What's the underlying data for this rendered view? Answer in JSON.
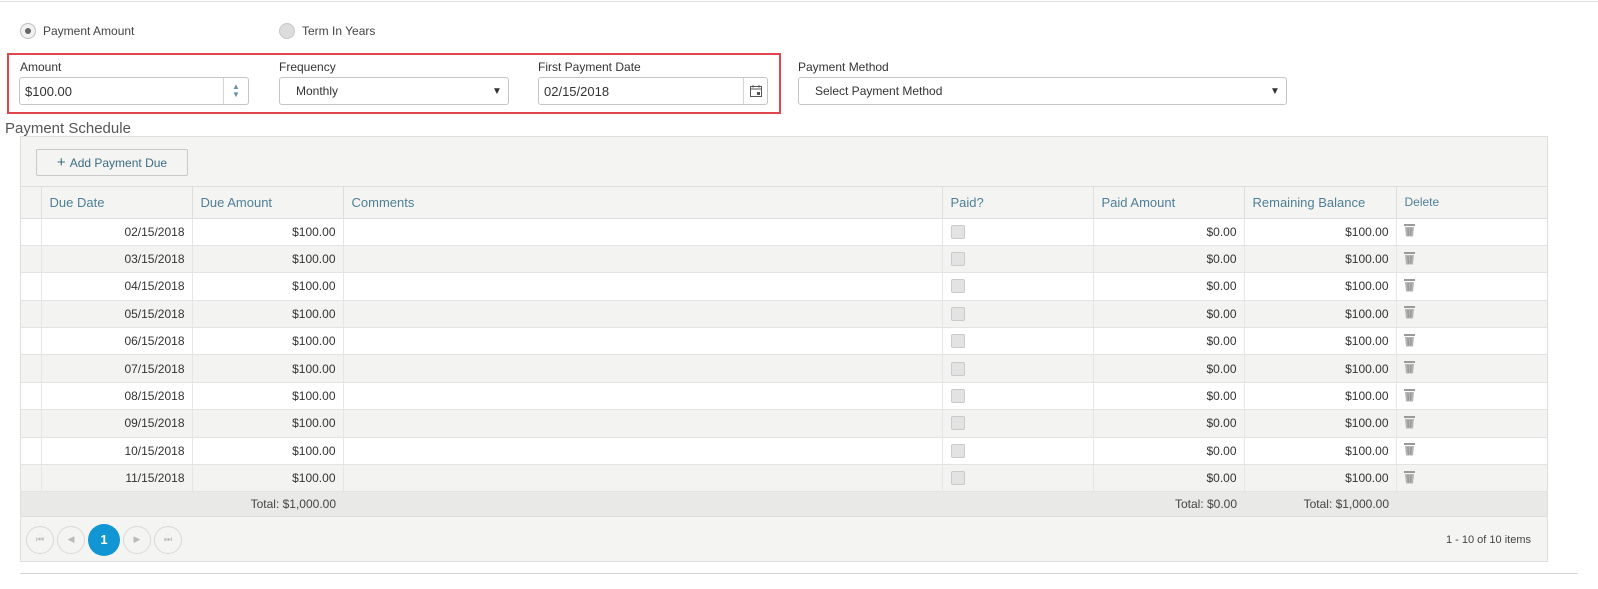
{
  "mode": {
    "option1": "Payment Amount",
    "option2": "Term In Years",
    "selected": "Payment Amount"
  },
  "fields": {
    "amount_label": "Amount",
    "amount_value": "$100.00",
    "frequency_label": "Frequency",
    "frequency_value": "Monthly",
    "first_date_label": "First Payment Date",
    "first_date_value": "02/15/2018",
    "method_label": "Payment Method",
    "method_value": "Select Payment Method"
  },
  "schedule": {
    "title": "Payment Schedule",
    "add_label": "Add Payment Due",
    "columns": [
      "Due Date",
      "Due Amount",
      "Comments",
      "Paid?",
      "Paid Amount",
      "Remaining Balance",
      "Delete"
    ],
    "rows": [
      {
        "due_date": "02/15/2018",
        "due_amount": "$100.00",
        "comments": "",
        "paid": false,
        "paid_amount": "$0.00",
        "remaining": "$100.00"
      },
      {
        "due_date": "03/15/2018",
        "due_amount": "$100.00",
        "comments": "",
        "paid": false,
        "paid_amount": "$0.00",
        "remaining": "$100.00"
      },
      {
        "due_date": "04/15/2018",
        "due_amount": "$100.00",
        "comments": "",
        "paid": false,
        "paid_amount": "$0.00",
        "remaining": "$100.00"
      },
      {
        "due_date": "05/15/2018",
        "due_amount": "$100.00",
        "comments": "",
        "paid": false,
        "paid_amount": "$0.00",
        "remaining": "$100.00"
      },
      {
        "due_date": "06/15/2018",
        "due_amount": "$100.00",
        "comments": "",
        "paid": false,
        "paid_amount": "$0.00",
        "remaining": "$100.00"
      },
      {
        "due_date": "07/15/2018",
        "due_amount": "$100.00",
        "comments": "",
        "paid": false,
        "paid_amount": "$0.00",
        "remaining": "$100.00"
      },
      {
        "due_date": "08/15/2018",
        "due_amount": "$100.00",
        "comments": "",
        "paid": false,
        "paid_amount": "$0.00",
        "remaining": "$100.00"
      },
      {
        "due_date": "09/15/2018",
        "due_amount": "$100.00",
        "comments": "",
        "paid": false,
        "paid_amount": "$0.00",
        "remaining": "$100.00"
      },
      {
        "due_date": "10/15/2018",
        "due_amount": "$100.00",
        "comments": "",
        "paid": false,
        "paid_amount": "$0.00",
        "remaining": "$100.00"
      },
      {
        "due_date": "11/15/2018",
        "due_amount": "$100.00",
        "comments": "",
        "paid": false,
        "paid_amount": "$0.00",
        "remaining": "$100.00"
      }
    ],
    "totals": {
      "due_amount": "Total: $1,000.00",
      "paid_amount": "Total: $0.00",
      "remaining": "Total: $1,000.00"
    }
  },
  "pager": {
    "current_page": "1",
    "info": "1 - 10 of 10 items"
  },
  "colors": {
    "accent": "#1195d3",
    "header_text": "#4e7f97",
    "highlight_border": "#e0474c"
  },
  "icons": [
    "calendar-icon",
    "trash-icon",
    "plus-icon",
    "spinner-icon",
    "dropdown-caret-icon"
  ]
}
